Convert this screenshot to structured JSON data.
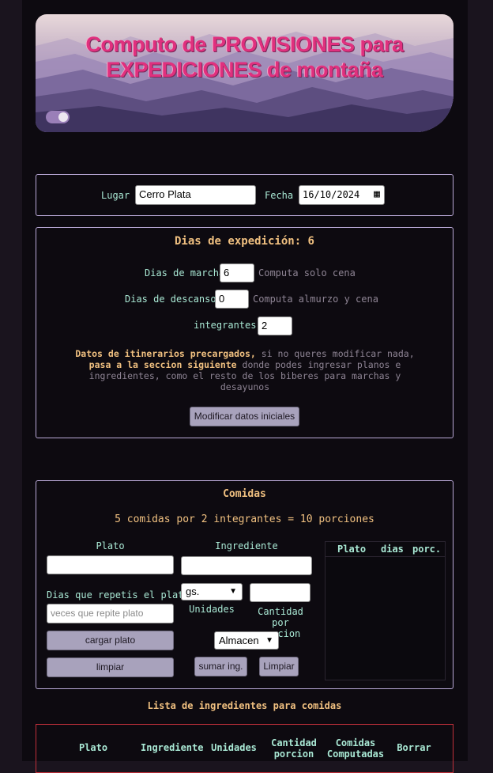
{
  "hero": {
    "title_line1": "Computo de PROVISIONES para",
    "title_line2": "EXPEDICIONES de montaña"
  },
  "trip": {
    "lugar_label": "Lugar",
    "lugar_value": "Cerro Plata",
    "fecha_label": "Fecha",
    "fecha_value": "16/10/2024"
  },
  "expedition": {
    "title": "Dias de expedición: 6",
    "marcha_label": "Dias de marcha",
    "marcha_value": "6",
    "marcha_note": "Computa solo cena",
    "descanso_label": "Dias de descansos",
    "descanso_value": "0",
    "descanso_note": "Computa almurzo y cena",
    "integrantes_label": "integrantes",
    "integrantes_value": "2",
    "info_bold1": "Datos de itinerarios precargados,",
    "info_text1": " si no queres modificar nada,",
    "info_bold2": "pasa a la seccion siguiente",
    "info_text2": " donde podes ingresar planos e",
    "info_text3": "ingredientes, como el resto de los biberes para marchas y",
    "info_text4": "desayunos",
    "modify_button": "Modificar datos iniciales"
  },
  "comidas": {
    "title": "Comidas",
    "summary": "5 comidas por 2 integrantes = 10 porciones",
    "plato_label": "Plato",
    "plato_value": "",
    "ingrediente_label": "Ingrediente",
    "ingrediente_value": "",
    "repetis_label": "Dias que repetis el plato",
    "repetis_placeholder": "veces que repite plato",
    "unit_selected": "gs.",
    "unidades_label": "Unidades",
    "cantidad_label_1": "Cantidad por",
    "cantidad_label_2": "porcion",
    "cantidad_value": "",
    "store_selected": "Almacen",
    "cargar_button": "cargar plato",
    "limpiar_button": "limpiar",
    "sumar_button": "sumar ing.",
    "limpiar2_button": "Limpiar",
    "mini_table_headers": [
      "Plato",
      "dias",
      "porc."
    ]
  },
  "lista": {
    "title": "Lista de ingredientes para comidas",
    "headers": [
      "Plato",
      "Ingrediente",
      "Unidades",
      "Cantidad porcion",
      "Comidas Computadas",
      "Borrar"
    ]
  }
}
